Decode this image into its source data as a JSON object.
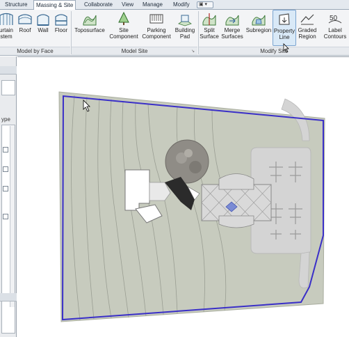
{
  "ribbon_tabs": [
    "Structure",
    "Massing & Site",
    "Collaborate",
    "View",
    "Manage",
    "Modify"
  ],
  "active_tab": "Massing & Site",
  "tab_extra_label": "▣ ▾",
  "panels": {
    "model_by_face": {
      "label": "Model by Face",
      "buttons": [
        {
          "line1": "urtain",
          "line2": "stem",
          "icon": "curtain-system-icon"
        },
        {
          "line1": "Roof",
          "line2": "",
          "icon": "roof-by-face-icon"
        },
        {
          "line1": "Wall",
          "line2": "",
          "icon": "wall-by-face-icon"
        },
        {
          "line1": "Floor",
          "line2": "",
          "icon": "floor-by-face-icon"
        }
      ]
    },
    "model_site": {
      "label": "Model Site",
      "buttons": [
        {
          "line1": "Toposurface",
          "line2": "",
          "icon": "toposurface-icon"
        },
        {
          "line1": "Site",
          "line2": "Component",
          "icon": "site-component-tree-icon"
        },
        {
          "line1": "Parking",
          "line2": "Component",
          "icon": "parking-component-icon"
        },
        {
          "line1": "Building",
          "line2": "Pad",
          "icon": "building-pad-icon"
        }
      ]
    },
    "modify_site": {
      "label": "Modify Site",
      "buttons": [
        {
          "line1": "Split",
          "line2": "Surface",
          "icon": "split-surface-icon"
        },
        {
          "line1": "Merge",
          "line2": "Surfaces",
          "icon": "merge-surfaces-icon"
        },
        {
          "line1": "Subregion",
          "line2": "",
          "icon": "subregion-icon"
        },
        {
          "line1": "Property",
          "line2": "Line",
          "icon": "property-line-icon"
        },
        {
          "line1": "Graded",
          "line2": "Region",
          "icon": "graded-region-icon"
        },
        {
          "line1": "Label",
          "line2": "Contours",
          "icon": "label-contours-icon"
        }
      ]
    }
  },
  "left_palette": {
    "partial_label": "ype"
  },
  "colors": {
    "ribbon_bg": "#f3f4f6",
    "terrain": "#c7cbbe",
    "contour": "#9a9e93",
    "property_line": "#3a2fc8",
    "paving": "#d4d4d4"
  }
}
